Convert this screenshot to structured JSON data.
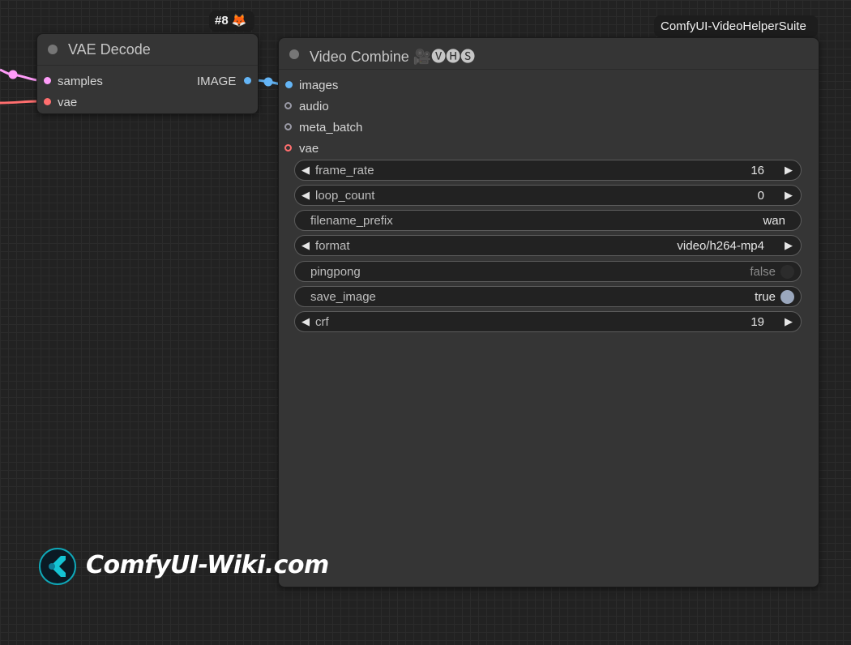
{
  "vae_decode": {
    "title": "VAE Decode",
    "badge": "#8 🦊",
    "inputs": [
      "samples",
      "vae"
    ],
    "output": "IMAGE"
  },
  "video_combine": {
    "title": "Video Combine 🎥🅥🅗🅢",
    "badge": "ComfyUI-VideoHelperSuite",
    "inputs": [
      "images",
      "audio",
      "meta_batch",
      "vae"
    ],
    "widgets": [
      {
        "name": "frame_rate",
        "value": "16",
        "kind": "number"
      },
      {
        "name": "loop_count",
        "value": "0",
        "kind": "number"
      },
      {
        "name": "filename_prefix",
        "value": "wan",
        "kind": "text"
      },
      {
        "name": "format",
        "value": "video/h264-mp4",
        "kind": "combo"
      },
      {
        "name": "pingpong",
        "value": "false",
        "kind": "toggle"
      },
      {
        "name": "save_image",
        "value": "true",
        "kind": "toggle"
      },
      {
        "name": "crf",
        "value": "19",
        "kind": "number"
      }
    ]
  },
  "watermark": {
    "text": "ComfyUI-Wiki.com"
  },
  "colors": {
    "latent": "#ff9cf9",
    "vae": "#ff6e6e",
    "image": "#64b5f6",
    "grey_slot": "#9a9aa6",
    "toggle_on": "#9aa7bd",
    "toggle_off": "#2c2c2c"
  },
  "icons": {
    "arrow_left": "◀",
    "arrow_right": "▶",
    "logo": "comfyui-wiki-logo"
  }
}
